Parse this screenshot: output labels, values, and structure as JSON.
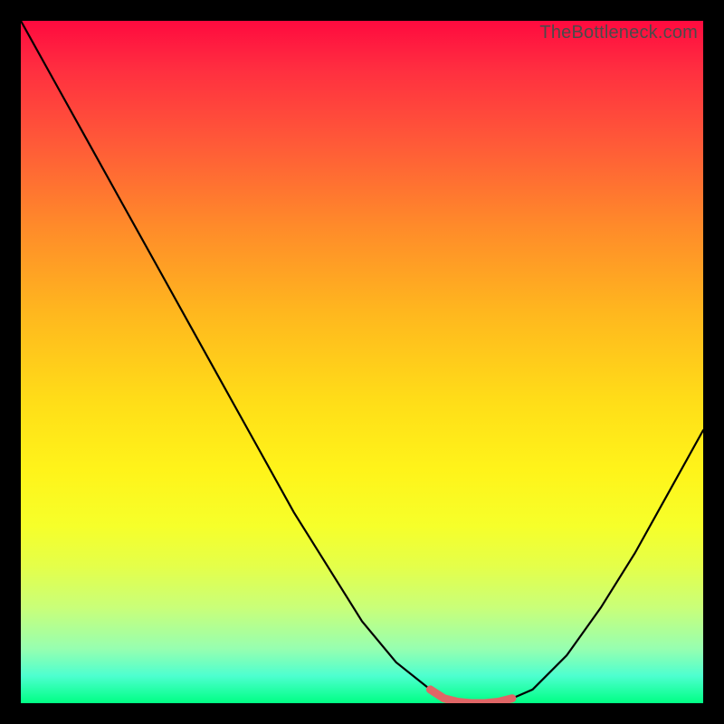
{
  "watermark": "TheBottleneck.com",
  "chart_data": {
    "type": "line",
    "title": "",
    "xlabel": "",
    "ylabel": "",
    "xlim": [
      0,
      100
    ],
    "ylim": [
      0,
      100
    ],
    "series": [
      {
        "name": "curve",
        "x": [
          0,
          5,
          10,
          15,
          20,
          25,
          30,
          35,
          40,
          45,
          50,
          55,
          60,
          62,
          64,
          66,
          68,
          70,
          72,
          75,
          80,
          85,
          90,
          95,
          100
        ],
        "values": [
          100,
          91,
          82,
          73,
          64,
          55,
          46,
          37,
          28,
          20,
          12,
          6,
          2,
          0.7,
          0.2,
          0,
          0,
          0.2,
          0.7,
          2,
          7,
          14,
          22,
          31,
          40
        ]
      },
      {
        "name": "highlight-band",
        "x": [
          60,
          62,
          64,
          66,
          68,
          70,
          72
        ],
        "values": [
          2,
          0.7,
          0.2,
          0,
          0,
          0.2,
          0.7
        ]
      }
    ],
    "annotations": [],
    "colors": {
      "curve": "#000000",
      "highlight": "#e06666",
      "background_top": "#ff0a3f",
      "background_bottom": "#00ff84"
    }
  }
}
